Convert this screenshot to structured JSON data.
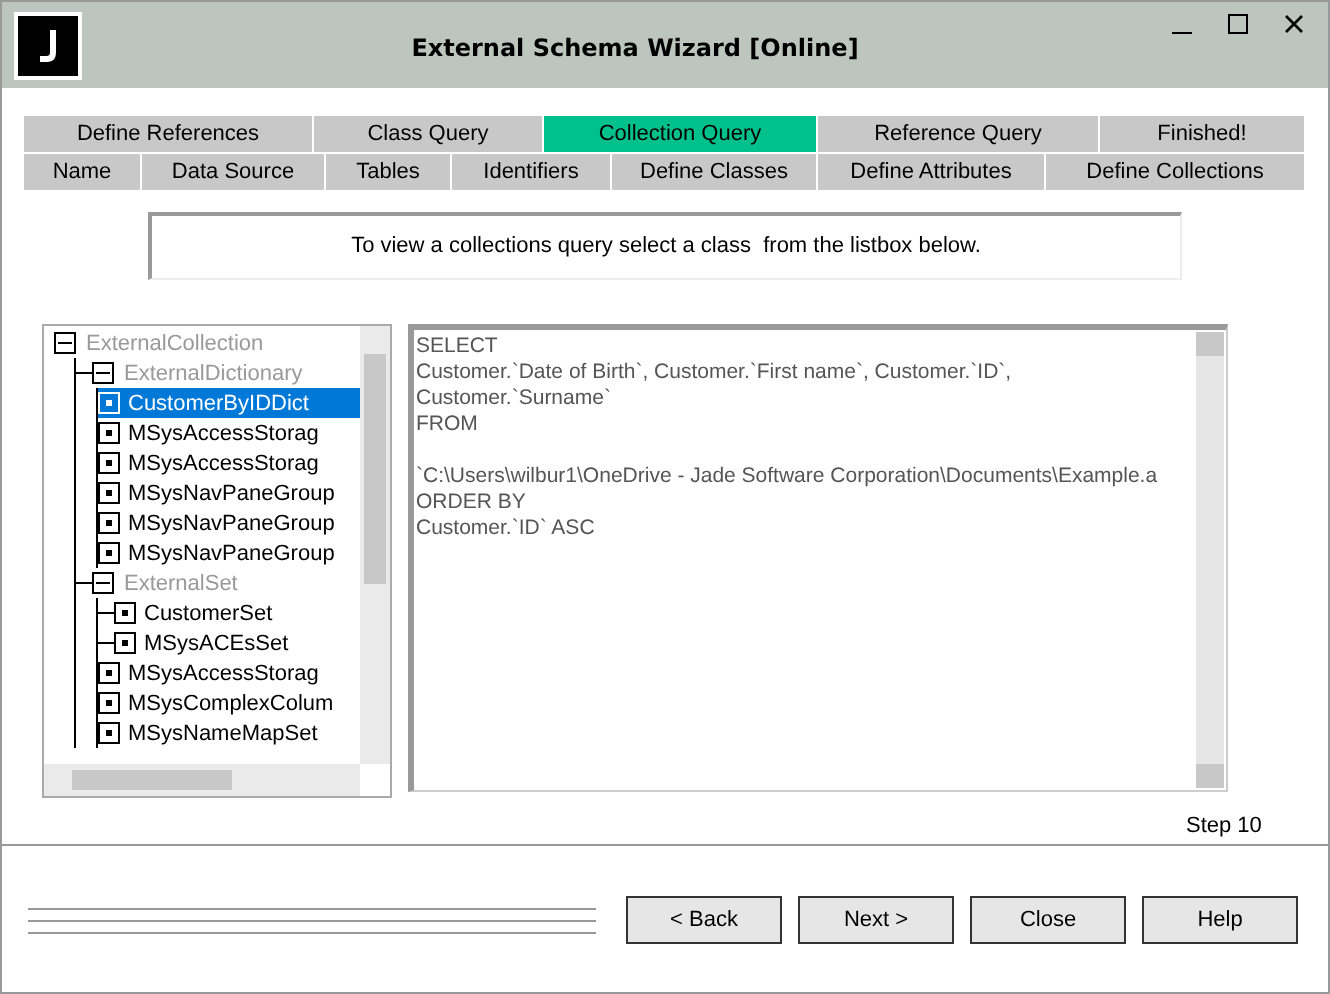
{
  "window": {
    "title": "External Schema Wizard [Online]"
  },
  "tabs_top": [
    {
      "label": "Define References",
      "selected": false
    },
    {
      "label": "Class Query",
      "selected": false
    },
    {
      "label": "Collection Query",
      "selected": true
    },
    {
      "label": "Reference Query",
      "selected": false
    },
    {
      "label": "Finished!",
      "selected": false
    }
  ],
  "tabs_bottom": [
    {
      "label": "Name",
      "selected": false
    },
    {
      "label": "Data Source",
      "selected": false
    },
    {
      "label": "Tables",
      "selected": false
    },
    {
      "label": "Identifiers",
      "selected": false
    },
    {
      "label": "Define Classes",
      "selected": false
    },
    {
      "label": "Define Attributes",
      "selected": false
    },
    {
      "label": "Define Collections",
      "selected": false
    }
  ],
  "instruction": "To view a collections query select a class  from the listbox below.",
  "tree": [
    {
      "label": "ExternalCollection",
      "kind": "folder",
      "expanded": true,
      "children": [
        {
          "label": "ExternalDictionary",
          "kind": "folder",
          "expanded": true,
          "children": [
            {
              "label": "CustomerByIDDict",
              "kind": "leaf",
              "selected": true
            },
            {
              "label": "MSysAccessStorag",
              "kind": "leaf",
              "selected": false
            },
            {
              "label": "MSysAccessStorag",
              "kind": "leaf",
              "selected": false
            },
            {
              "label": "MSysNavPaneGroup",
              "kind": "leaf",
              "selected": false
            },
            {
              "label": "MSysNavPaneGroup",
              "kind": "leaf",
              "selected": false
            },
            {
              "label": "MSysNavPaneGroup",
              "kind": "leaf",
              "selected": false
            }
          ]
        },
        {
          "label": "ExternalSet",
          "kind": "folder",
          "expanded": true,
          "children": [
            {
              "label": "CustomerSet",
              "kind": "leaf",
              "selected": false
            },
            {
              "label": "MSysACEsSet",
              "kind": "leaf",
              "selected": false
            },
            {
              "label": "MSysAccessStorag",
              "kind": "leaf",
              "selected": false
            },
            {
              "label": "MSysComplexColum",
              "kind": "leaf",
              "selected": false
            },
            {
              "label": "MSysNameMapSet",
              "kind": "leaf",
              "selected": false
            }
          ]
        }
      ]
    }
  ],
  "query": "SELECT\nCustomer.`Date of Birth`, Customer.`First name`, Customer.`ID`,\nCustomer.`Surname`\nFROM\n\n`C:\\Users\\wilbur1\\OneDrive - Jade Software Corporation\\Documents\\Example.a\nORDER BY\nCustomer.`ID` ASC",
  "step": "Step 10",
  "buttons": [
    "< Back",
    "Next >",
    "Close",
    "Help"
  ]
}
